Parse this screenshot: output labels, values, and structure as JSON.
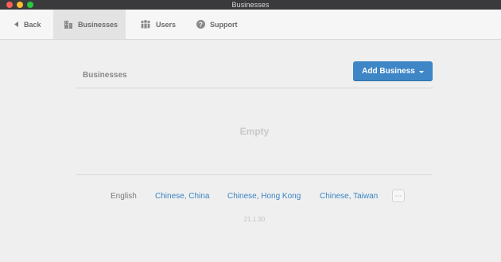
{
  "window": {
    "title": "Businesses"
  },
  "toolbar": {
    "back_label": "Back",
    "tabs": [
      {
        "label": "Businesses",
        "icon": "buildings-icon",
        "active": true
      },
      {
        "label": "Users",
        "icon": "users-icon",
        "active": false
      },
      {
        "label": "Support",
        "icon": "help-circle-icon",
        "active": false
      }
    ]
  },
  "businesses": {
    "heading": "Businesses",
    "add_button_label": "Add Business",
    "empty_text": "Empty"
  },
  "footer": {
    "current_language": "English",
    "languages": [
      "Chinese, China",
      "Chinese, Hong Kong",
      "Chinese, Taiwan"
    ],
    "more_button_icon": "ellipsis-icon",
    "version": "21.1.30"
  },
  "colors": {
    "accent": "#3f86c7",
    "link": "#3a84c4",
    "titlebar": "#3a3a3c",
    "background": "#efefef"
  }
}
